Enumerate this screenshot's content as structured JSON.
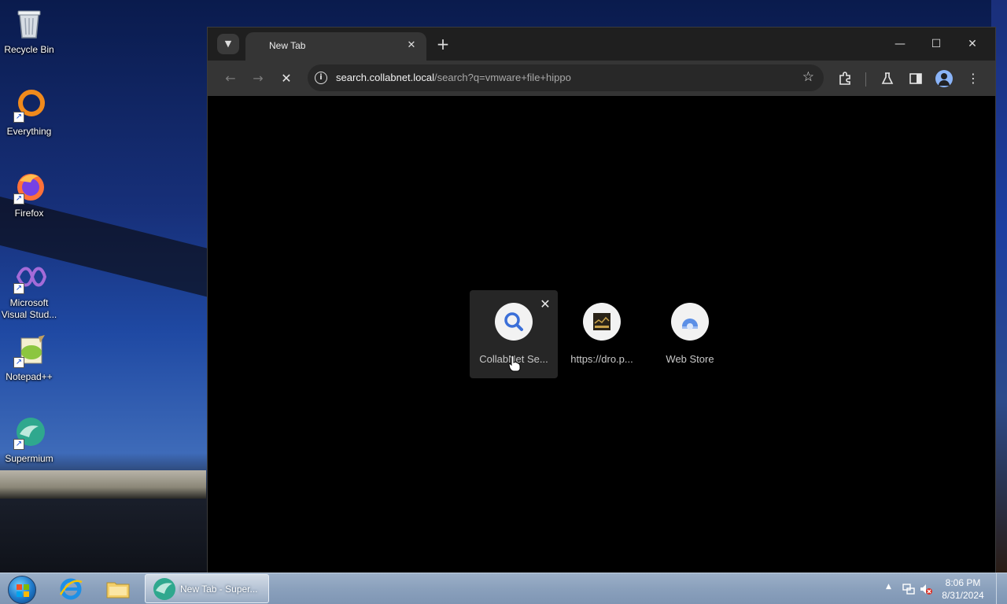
{
  "desktop": {
    "icons": [
      {
        "label": "Recycle Bin",
        "icon": "recycle-bin-icon"
      },
      {
        "label": "Everything",
        "icon": "everything-icon"
      },
      {
        "label": "Firefox",
        "icon": "firefox-icon"
      },
      {
        "label": "Microsoft Visual Stud...",
        "icon": "visual-studio-icon"
      },
      {
        "label": "Notepad++",
        "icon": "notepad-plus-plus-icon"
      },
      {
        "label": "Supermium",
        "icon": "supermium-icon"
      }
    ]
  },
  "browser": {
    "tab": {
      "title": "New Tab"
    },
    "url": {
      "host": "search.collabnet.local",
      "path": "/search?q=vmware+file+hippo"
    },
    "shortcuts": [
      {
        "label": "CollabNet Se...",
        "icon": "search-icon"
      },
      {
        "label": "https://dro.p...",
        "icon": "site-favicon-icon"
      },
      {
        "label": "Web Store",
        "icon": "web-store-icon"
      }
    ],
    "colors": {
      "accent": "#8ab4f8",
      "background": "#000000",
      "toolbar": "#353535"
    }
  },
  "taskbar": {
    "task_label": "New Tab - Super...",
    "clock_time": "8:06 PM",
    "clock_date": "8/31/2024"
  }
}
